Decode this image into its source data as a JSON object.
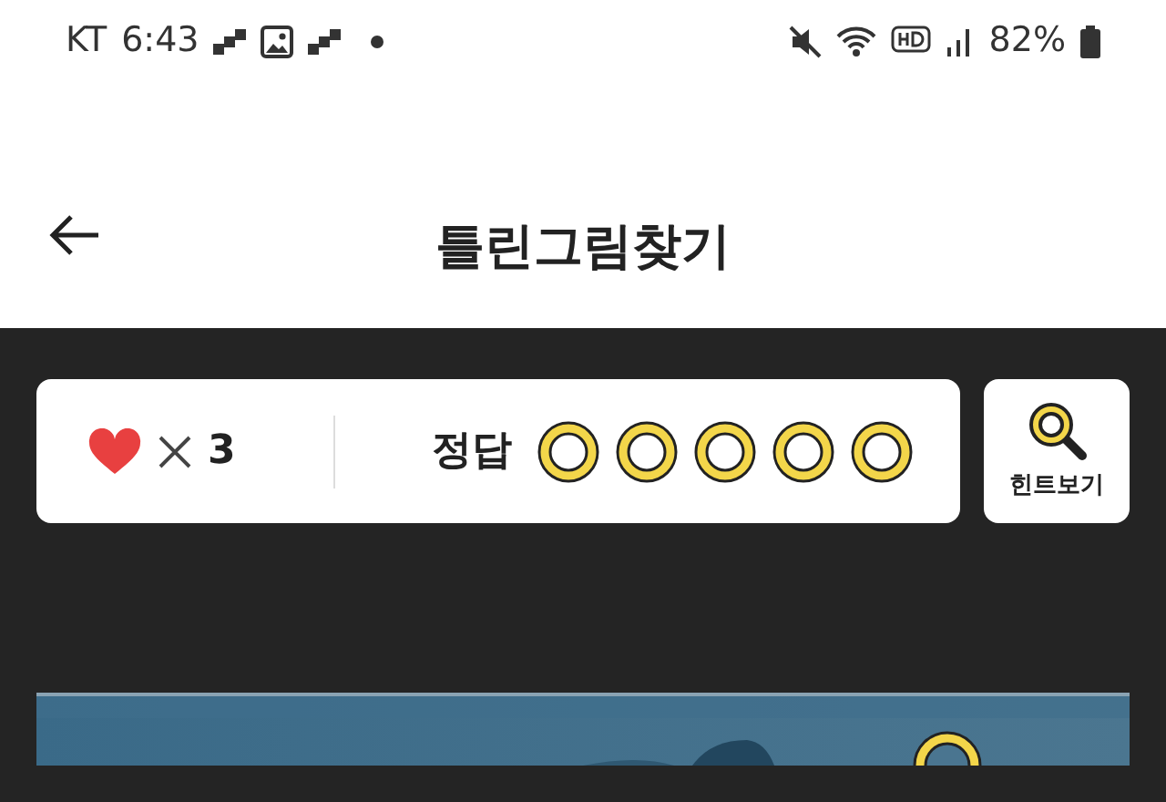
{
  "status_bar": {
    "carrier": "KT",
    "time": "6:43",
    "battery": "82%"
  },
  "header": {
    "title": "틀린그림찾기"
  },
  "score": {
    "lives": "3",
    "answer_label": "정답",
    "answers": [
      {
        "found": false
      },
      {
        "found": false
      },
      {
        "found": false
      },
      {
        "found": false
      },
      {
        "found": false
      }
    ]
  },
  "hint_button": {
    "label": "힌트보기"
  }
}
